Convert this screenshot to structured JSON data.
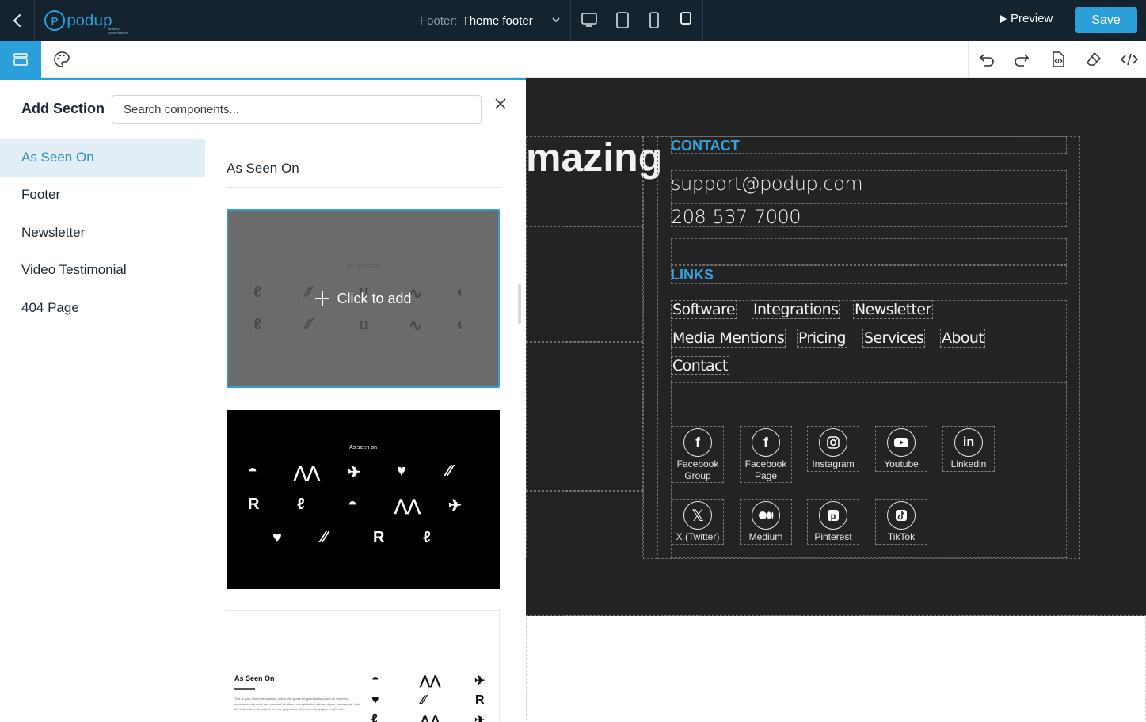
{
  "topbar": {
    "logo_text": "podup",
    "logo_subtext": "formerly ShowPlatform",
    "footer_label": "Footer:",
    "footer_value": "Theme footer",
    "preview_label": "Preview",
    "save_label": "Save"
  },
  "panel": {
    "title": "Add Section",
    "search_placeholder": "Search components...",
    "categories": [
      {
        "label": "As Seen On",
        "active": true
      },
      {
        "label": "Footer",
        "active": false
      },
      {
        "label": "Newsletter",
        "active": false
      },
      {
        "label": "Video Testimonial",
        "active": false
      },
      {
        "label": "404 Page",
        "active": false
      }
    ],
    "section_title": "As Seen On",
    "click_to_add": "Click to add",
    "card1_heading": "AS SEEN ON",
    "card2_heading": "As seen on",
    "card3_heading": "As Seen On",
    "card3_body": "This is your Client description. Utilize the space for good background on the client, summarize the work you provided for them, or explain the nature of your partnership. Add the button to lead readers to more projects or other relevant pages in your site."
  },
  "canvas": {
    "heading_partial": "mazing",
    "contact_heading": "CONTACT",
    "email": "support@podup.com",
    "phone": "208-537-7000",
    "links_heading": "LINKS",
    "links": [
      "Software",
      "Integrations",
      "Newsletter",
      "Media Mentions",
      "Pricing",
      "Services",
      "About",
      "Contact"
    ],
    "socials": [
      {
        "label": "Facebook Group",
        "icon": "facebook-icon"
      },
      {
        "label": "Facebook Page",
        "icon": "facebook-icon"
      },
      {
        "label": "Instagram",
        "icon": "instagram-icon"
      },
      {
        "label": "Youtube",
        "icon": "youtube-icon"
      },
      {
        "label": "Linkedin",
        "icon": "linkedin-icon"
      },
      {
        "label": "X (Twitter)",
        "icon": "x-icon"
      },
      {
        "label": "Medium",
        "icon": "medium-icon"
      },
      {
        "label": "Pinterest",
        "icon": "pinterest-icon"
      },
      {
        "label": "TikTok",
        "icon": "tiktok-icon"
      }
    ]
  },
  "colors": {
    "accent": "#2b9fd9",
    "topbar_bg": "#15232f",
    "canvas_bg": "#232323",
    "link_heading": "#36a2dc"
  }
}
